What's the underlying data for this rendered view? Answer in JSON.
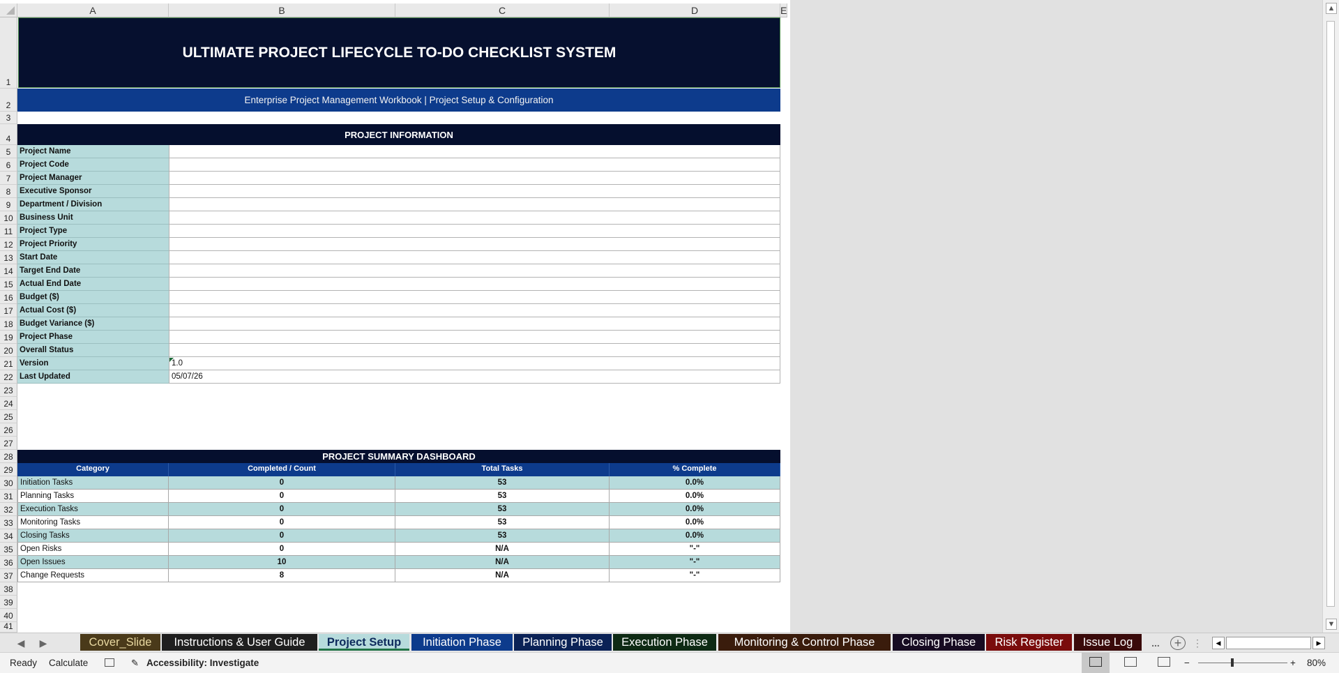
{
  "columns": [
    "A",
    "B",
    "C",
    "D",
    "E"
  ],
  "rows": [
    "1",
    "2",
    "3",
    "4",
    "5",
    "6",
    "7",
    "8",
    "9",
    "10",
    "11",
    "12",
    "13",
    "14",
    "15",
    "16",
    "17",
    "18",
    "19",
    "20",
    "21",
    "22",
    "23",
    "24",
    "25",
    "26",
    "27",
    "28",
    "29",
    "30",
    "31",
    "32",
    "33",
    "34",
    "35",
    "36",
    "37",
    "38",
    "39",
    "40",
    "41"
  ],
  "title": "ULTIMATE PROJECT LIFECYCLE TO-DO CHECKLIST SYSTEM",
  "subtitle": "Enterprise Project Management Workbook | Project Setup & Configuration",
  "project_info": {
    "header": "PROJECT INFORMATION",
    "fields": [
      {
        "label": "Project Name",
        "value": ""
      },
      {
        "label": "Project Code",
        "value": ""
      },
      {
        "label": "Project Manager",
        "value": ""
      },
      {
        "label": "Executive Sponsor",
        "value": ""
      },
      {
        "label": "Department / Division",
        "value": ""
      },
      {
        "label": "Business Unit",
        "value": ""
      },
      {
        "label": "Project Type",
        "value": ""
      },
      {
        "label": "Project Priority",
        "value": ""
      },
      {
        "label": "Start Date",
        "value": ""
      },
      {
        "label": "Target End Date",
        "value": ""
      },
      {
        "label": "Actual End Date",
        "value": ""
      },
      {
        "label": "Budget ($)",
        "value": ""
      },
      {
        "label": "Actual Cost ($)",
        "value": ""
      },
      {
        "label": "Budget Variance ($)",
        "value": ""
      },
      {
        "label": "Project Phase",
        "value": ""
      },
      {
        "label": "Overall Status",
        "value": ""
      },
      {
        "label": "Version",
        "value": "1.0"
      },
      {
        "label": "Last Updated",
        "value": "05/07/26"
      }
    ]
  },
  "summary": {
    "header": "PROJECT SUMMARY DASHBOARD",
    "columns": [
      "Category",
      "Completed / Count",
      "Total Tasks",
      "% Complete"
    ],
    "rows": [
      [
        "Initiation Tasks",
        "0",
        "53",
        "0.0%"
      ],
      [
        "Planning Tasks",
        "0",
        "53",
        "0.0%"
      ],
      [
        "Execution Tasks",
        "0",
        "53",
        "0.0%"
      ],
      [
        "Monitoring Tasks",
        "0",
        "53",
        "0.0%"
      ],
      [
        "Closing Tasks",
        "0",
        "53",
        "0.0%"
      ],
      [
        "Open Risks",
        "0",
        "N/A",
        "\"-\""
      ],
      [
        "Open Issues",
        "10",
        "N/A",
        "\"-\""
      ],
      [
        "Change Requests",
        "8",
        "N/A",
        "\"-\""
      ]
    ]
  },
  "tabs": [
    {
      "label": "Cover_Slide",
      "bg": "#4a3a1a",
      "fg": "#e8d8a0"
    },
    {
      "label": "Instructions & User Guide",
      "bg": "#1f1f1f",
      "fg": "#ffffff"
    },
    {
      "label": "Project Setup",
      "bg": "#b7dbdc",
      "fg": "#0d2a5c",
      "active": true
    },
    {
      "label": "Initiation Phase",
      "bg": "#0d3b8c",
      "fg": "#ffffff"
    },
    {
      "label": "Planning Phase",
      "bg": "#0b2256",
      "fg": "#ffffff"
    },
    {
      "label": "Execution Phase",
      "bg": "#0e2a14",
      "fg": "#ffffff"
    },
    {
      "label": "Monitoring & Control Phase",
      "bg": "#3a1c0c",
      "fg": "#ffffff"
    },
    {
      "label": "Closing Phase",
      "bg": "#170c22",
      "fg": "#ffffff"
    },
    {
      "label": "Risk Register",
      "bg": "#7a0c0c",
      "fg": "#ffffff"
    },
    {
      "label": "Issue Log",
      "bg": "#3a0a0a",
      "fg": "#ffffff"
    }
  ],
  "tabbar": {
    "more": "...",
    "add": "+"
  },
  "status": {
    "ready": "Ready",
    "calculate": "Calculate",
    "accessibility": "Accessibility: Investigate",
    "zoom": "80%",
    "zoom_minus": "−",
    "zoom_plus": "+"
  },
  "icons": {
    "scroll_left": "◀",
    "scroll_right": "▶",
    "scroll_up": "▲",
    "scroll_down": "▼"
  }
}
